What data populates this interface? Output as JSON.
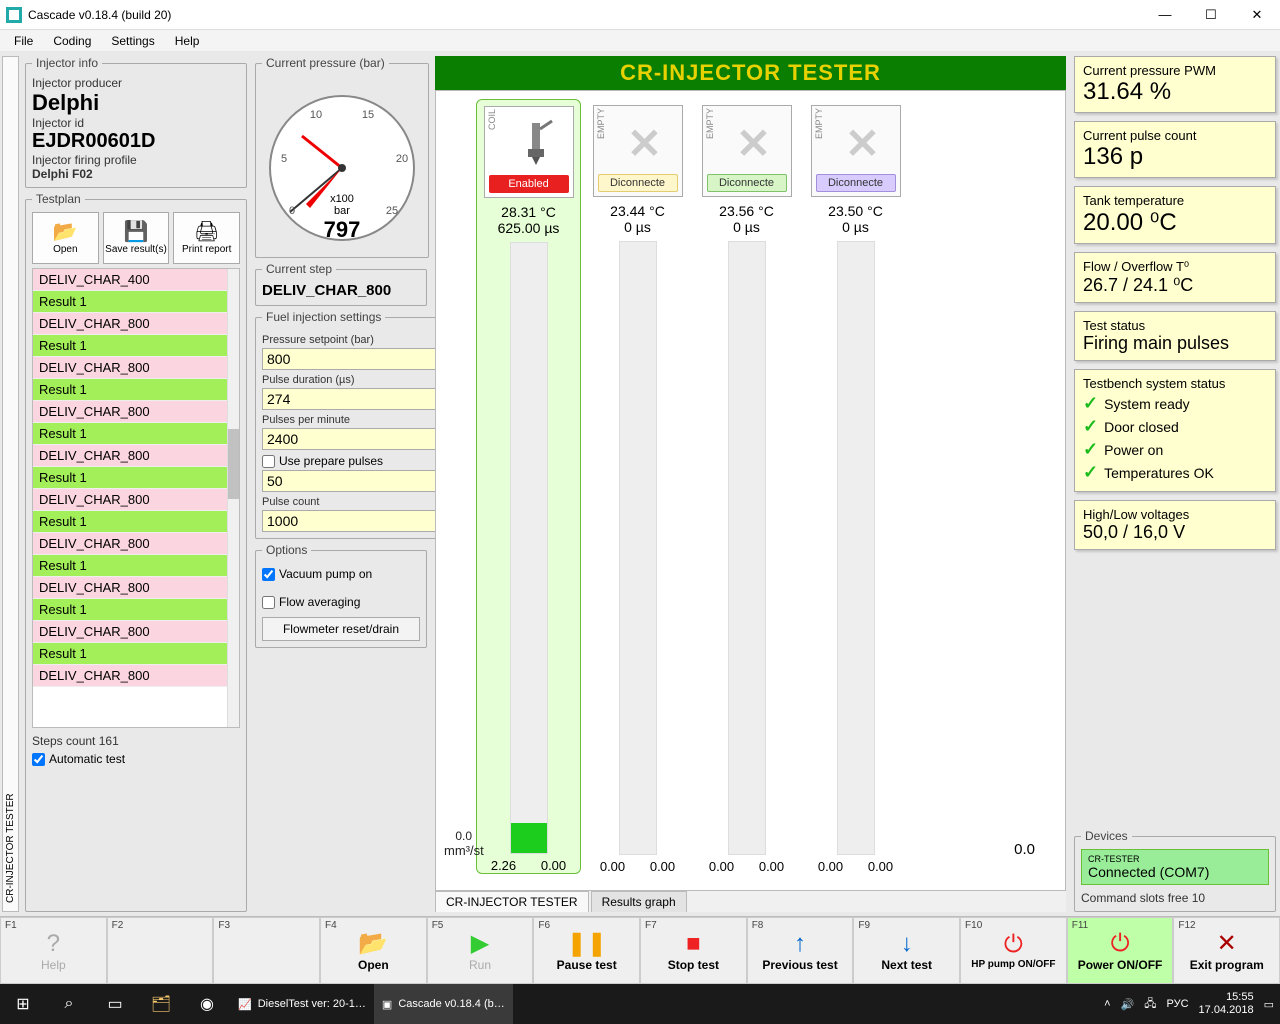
{
  "window": {
    "title": "Cascade v0.18.4 (build 20)"
  },
  "menu": {
    "file": "File",
    "coding": "Coding",
    "settings": "Settings",
    "help": "Help"
  },
  "sidetab": "CR-INJECTOR TESTER",
  "injector_info": {
    "legend": "Injector info",
    "producer_lbl": "Injector producer",
    "producer": "Delphi",
    "id_lbl": "Injector id",
    "id": "EJDR00601D",
    "profile_lbl": "Injector firing profile",
    "profile": "Delphi F02"
  },
  "testplan": {
    "legend": "Testplan",
    "open": "Open",
    "save": "Save result(s)",
    "print": "Print report",
    "items": [
      {
        "txt": "DELIV_CHAR_400",
        "cls": "pink"
      },
      {
        "txt": "Result 1",
        "cls": "green"
      },
      {
        "txt": "DELIV_CHAR_800",
        "cls": "pink"
      },
      {
        "txt": "Result 1",
        "cls": "green"
      },
      {
        "txt": "DELIV_CHAR_800",
        "cls": "pink"
      },
      {
        "txt": "Result 1",
        "cls": "green"
      },
      {
        "txt": "DELIV_CHAR_800",
        "cls": "pink"
      },
      {
        "txt": "Result 1",
        "cls": "green"
      },
      {
        "txt": "DELIV_CHAR_800",
        "cls": "pink"
      },
      {
        "txt": "Result 1",
        "cls": "green"
      },
      {
        "txt": "DELIV_CHAR_800",
        "cls": "pink"
      },
      {
        "txt": "Result 1",
        "cls": "green"
      },
      {
        "txt": "DELIV_CHAR_800",
        "cls": "pink"
      },
      {
        "txt": "Result 1",
        "cls": "green"
      },
      {
        "txt": "DELIV_CHAR_800",
        "cls": "pink"
      },
      {
        "txt": "Result 1",
        "cls": "green"
      },
      {
        "txt": "DELIV_CHAR_800",
        "cls": "pink"
      },
      {
        "txt": "Result 1",
        "cls": "green"
      },
      {
        "txt": "DELIV_CHAR_800",
        "cls": "pink"
      }
    ],
    "steps_count_lbl": "Steps count ",
    "steps_count": "161",
    "auto_test": "Automatic test"
  },
  "gauge": {
    "legend": "Current pressure (bar)",
    "unit1": "x100",
    "unit2": "bar",
    "value": "797",
    "ticks": {
      "t0": "0",
      "t5": "5",
      "t10": "10",
      "t15": "15",
      "t20": "20",
      "t25": "25"
    }
  },
  "current_step": {
    "legend": "Current step",
    "name": "DELIV_CHAR_800"
  },
  "fuel": {
    "legend": "Fuel injection settings",
    "pressure_lbl": "Pressure setpoint (bar)",
    "pressure": "800",
    "pulse_dur_lbl": "Pulse duration (µs)",
    "pulse_dur": "274",
    "ppm_lbl": "Pulses per minute",
    "ppm": "2400",
    "use_prepare": "Use prepare pulses",
    "prepare_val": "50",
    "pulse_count_lbl": "Pulse count",
    "pulse_count": "1000"
  },
  "options": {
    "legend": "Options",
    "vacuum": "Vacuum pump on",
    "flow_avg": "Flow averaging",
    "flowmeter_btn": "Flowmeter reset/drain"
  },
  "center": {
    "title": "CR-INJECTOR TESTER",
    "axis_zero": "0.0",
    "axis_unit": "mm³/st",
    "axis_zero_right": "0.0",
    "injectors": [
      {
        "side": "COIL",
        "status": "Enabled",
        "status_cls": "red",
        "temp": "28.31 °C",
        "pulse": "625.00 µs",
        "v1": "2.26",
        "v2": "0.00",
        "fill": 5,
        "active": true
      },
      {
        "side": "EMPTY",
        "status": "Diconnecte",
        "status_cls": "yellow",
        "temp": "23.44 °C",
        "pulse": "0 µs",
        "v1": "0.00",
        "v2": "0.00",
        "fill": 0,
        "active": false
      },
      {
        "side": "EMPTY",
        "status": "Diconnecte",
        "status_cls": "green",
        "temp": "23.56 °C",
        "pulse": "0 µs",
        "v1": "0.00",
        "v2": "0.00",
        "fill": 0,
        "active": false
      },
      {
        "side": "EMPTY",
        "status": "Diconnecte",
        "status_cls": "purple",
        "temp": "23.50 °C",
        "pulse": "0 µs",
        "v1": "0.00",
        "v2": "0.00",
        "fill": 0,
        "active": false
      }
    ],
    "tabs": {
      "tester": "CR-INJECTOR TESTER",
      "results": "Results graph"
    }
  },
  "right": {
    "pwm": {
      "lbl": "Current pressure PWM",
      "val": "31.64 %"
    },
    "pulses": {
      "lbl": "Current pulse count",
      "val": "136 p"
    },
    "tank": {
      "lbl": "Tank temperature",
      "val": "20.00 ⁰C"
    },
    "flow": {
      "lbl": "Flow / Overflow T⁰",
      "val": "26.7 / 24.1 ⁰C"
    },
    "test_status": {
      "lbl": "Test status",
      "val": "Firing main pulses"
    },
    "system": {
      "lbl": "Testbench system status",
      "items": [
        "System ready",
        "Door closed",
        "Power on",
        "Temperatures OK"
      ]
    },
    "volt": {
      "lbl": "High/Low voltages",
      "val": "50,0 / 16,0 V"
    },
    "devices": {
      "legend": "Devices",
      "name": "CR-TESTER",
      "conn": "Connected (COM7)",
      "slots": "Command slots free 10"
    }
  },
  "fnbar": {
    "f1": "Help",
    "f2": "",
    "f3": "",
    "f4": "Open",
    "f5": "Run",
    "f6": "Pause test",
    "f7": "Stop test",
    "f8": "Previous test",
    "f9": "Next test",
    "f10": "HP pump ON/OFF",
    "f11": "Power ON/OFF",
    "f12": "Exit program"
  },
  "taskbar": {
    "task1": "DieselTest ver: 20-1…",
    "task2": "Cascade v0.18.4 (b…",
    "lang": "РУС",
    "time": "15:55",
    "date": "17.04.2018"
  }
}
